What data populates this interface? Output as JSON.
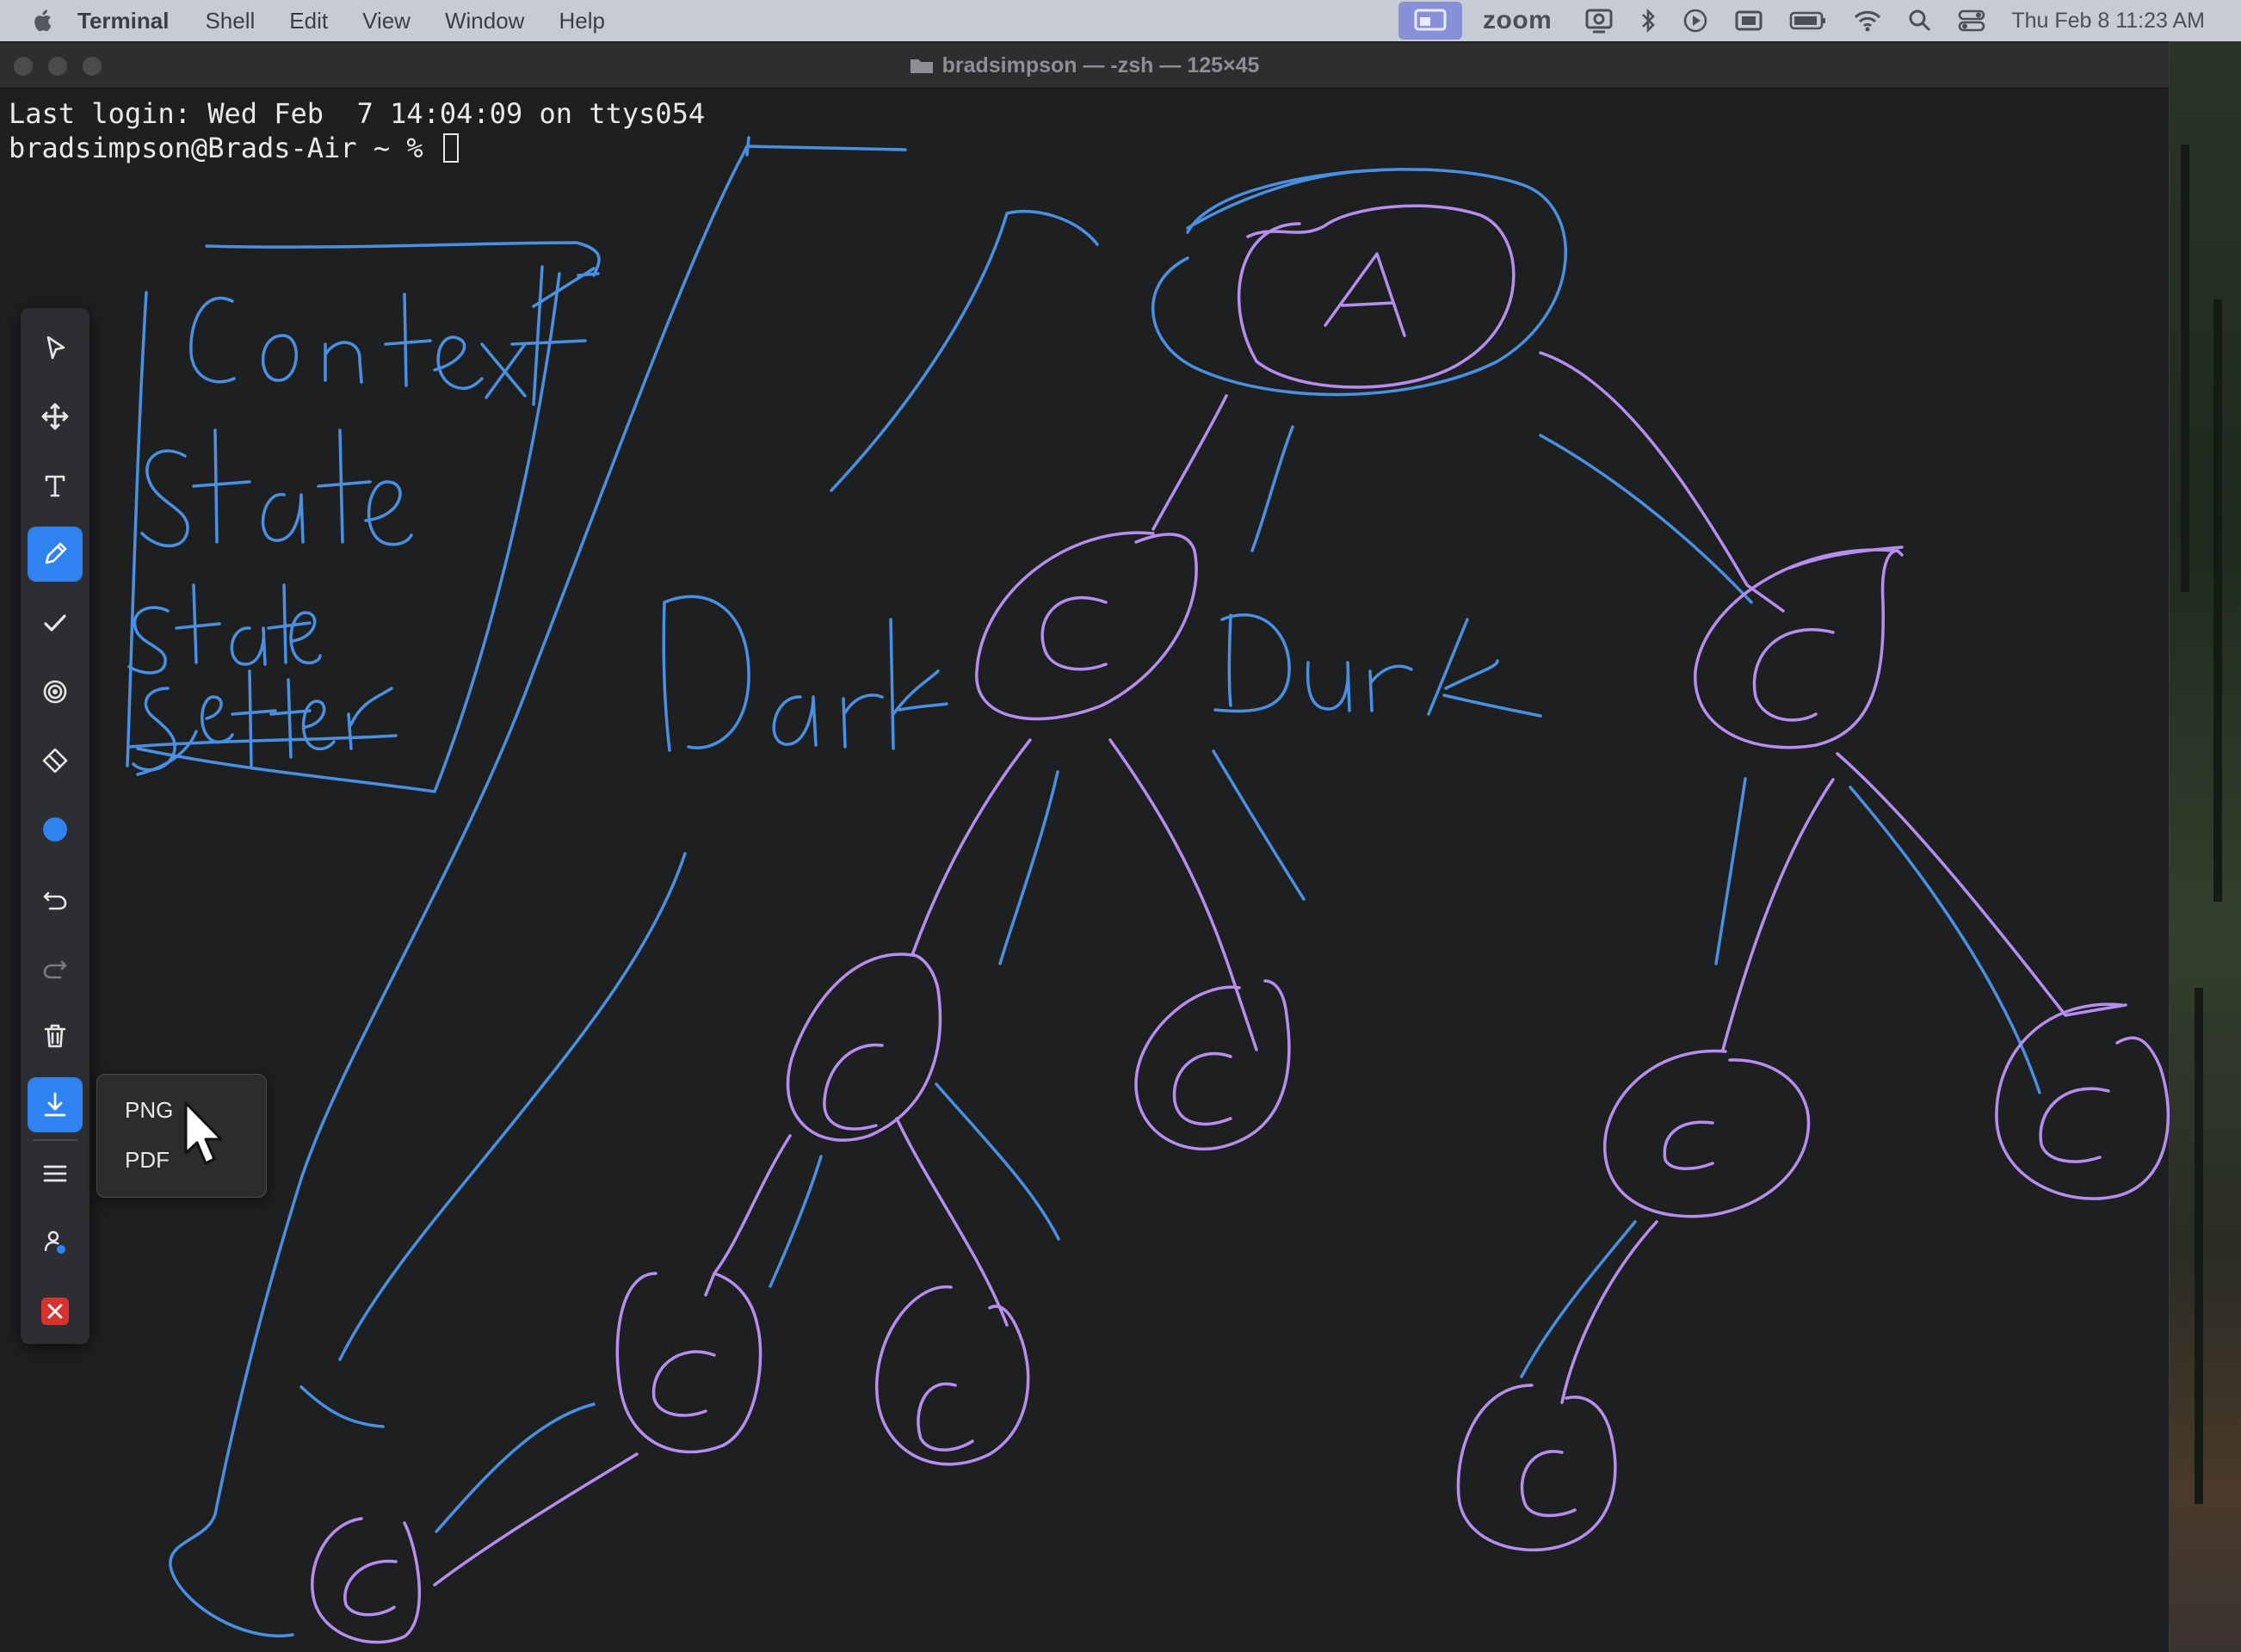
{
  "menubar": {
    "app_name": "Terminal",
    "menus": [
      "Shell",
      "Edit",
      "View",
      "Window",
      "Help"
    ],
    "zoom_label": "zoom",
    "clock": "Thu Feb 8  11:23 AM"
  },
  "window": {
    "title": "bradsimpson — -zsh — 125×45",
    "lines": [
      "Last login: Wed Feb  7 14:04:09 on ttys054",
      "bradsimpson@Brads-Air ~ % "
    ]
  },
  "sketch": {
    "words": [
      "Context",
      "State",
      "State",
      "Setter",
      "Dark",
      "Dark",
      "A",
      "C"
    ],
    "colors": {
      "pen_blue": "#4a90e2",
      "pen_purple": "#b78ef0"
    }
  },
  "toolbar": {
    "tools": [
      "select",
      "move",
      "text",
      "pen",
      "check",
      "spotlight",
      "eraser",
      "color",
      "undo",
      "redo",
      "delete",
      "download",
      "menu",
      "participants",
      "close"
    ],
    "active_tools": [
      "pen",
      "download"
    ],
    "current_color": "#2f83f0"
  },
  "export_menu": {
    "png_label": "PNG",
    "pdf_label": "PDF"
  }
}
